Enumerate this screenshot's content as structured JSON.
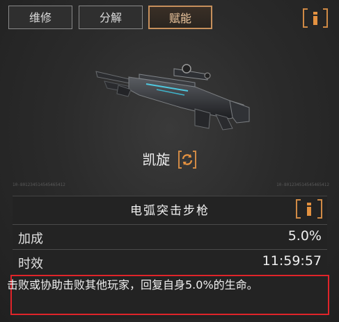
{
  "tabs": [
    {
      "label": "维修",
      "active": false
    },
    {
      "label": "分解",
      "active": false
    },
    {
      "label": "赋能",
      "active": true
    }
  ],
  "info_icon": "info-icon",
  "weapon": {
    "name": "凯旋",
    "swap_icon": "swap-icon",
    "serial_left": "10-801234514545465412",
    "serial_right": "10-801234514545465412"
  },
  "panel": {
    "title": "电弧突击步枪",
    "rows": [
      {
        "label": "加成",
        "value": "5.0%"
      },
      {
        "label": "时效",
        "value": "11:59:57"
      }
    ],
    "description": "击败或协助击败其他玩家，回复自身5.0%的生命。"
  },
  "colors": {
    "accent": "#d08a45",
    "highlight_border": "#e0242a",
    "background": "#262626"
  }
}
